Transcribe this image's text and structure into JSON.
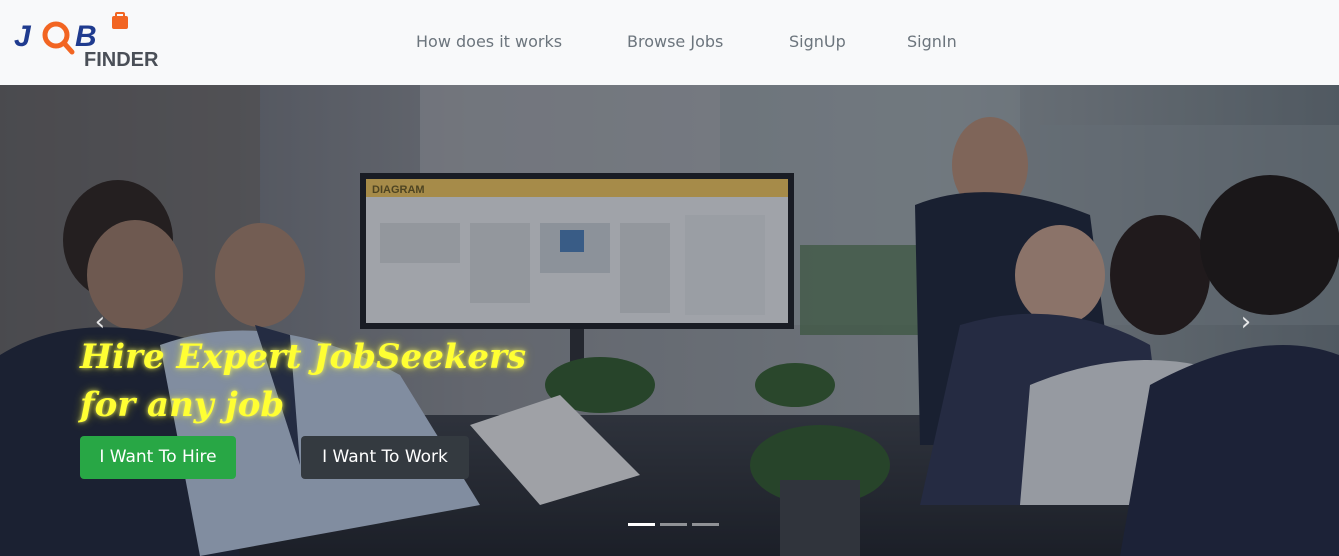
{
  "logo": {
    "job": "JOB",
    "finder": "FINDER"
  },
  "nav": {
    "items": [
      {
        "label": "How does it works"
      },
      {
        "label": "Browse Jobs"
      },
      {
        "label": "SignUp"
      },
      {
        "label": "SignIn"
      }
    ]
  },
  "hero": {
    "headline_line1": "Hire Expert JobSeekers",
    "headline_line2": "for any job",
    "hire_button": "I Want To Hire",
    "work_button": "I Want To Work",
    "prev_icon": "chevron-left-icon",
    "next_icon": "chevron-right-icon",
    "slide_count": 3,
    "active_slide": 1,
    "screen_label": "DIAGRAM"
  },
  "colors": {
    "navbar_bg": "#f8f9fa",
    "nav_text": "#6c757d",
    "logo_blue": "#1f3b8f",
    "logo_orange": "#f26522",
    "headline": "#ffff33",
    "hire_btn": "#28a745",
    "work_btn": "#343a40"
  }
}
